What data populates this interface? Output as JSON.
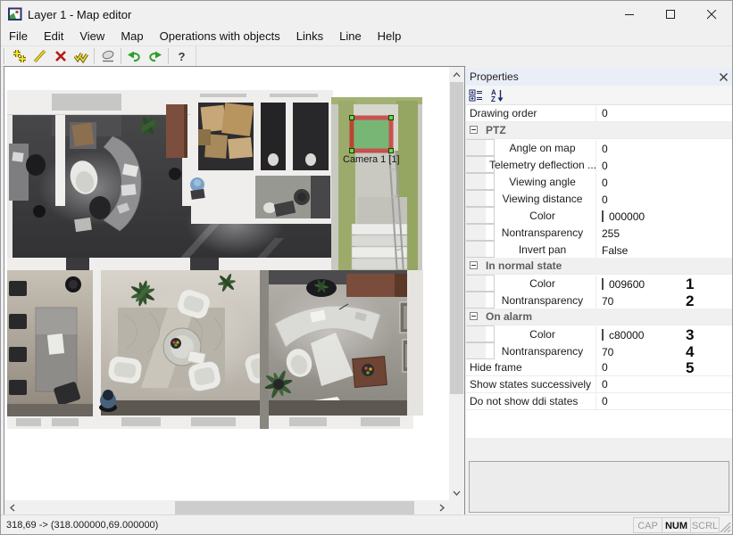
{
  "window": {
    "title": "Layer 1 - Map editor"
  },
  "menu": {
    "items": [
      "File",
      "Edit",
      "View",
      "Map",
      "Operations with objects",
      "Links",
      "Line",
      "Help"
    ]
  },
  "toolbar": {
    "buttons": [
      "Add points",
      "Draw line",
      "Delete",
      "Edit points",
      "Eraser",
      "Undo",
      "Redo",
      "Help"
    ]
  },
  "map_view": {
    "camera_label": "Camera 1 [1]"
  },
  "colors": {
    "camera_frame": "#c32020",
    "camera_fill": "#55aa55",
    "normal_state": "#009600",
    "alarm": "#c80000",
    "ptz_color": "#000000"
  },
  "properties_panel": {
    "title": "Properties",
    "toolbar_icons": [
      "categorized",
      "sort-alphabetical"
    ],
    "rows": [
      {
        "type": "item",
        "label": "Drawing order",
        "value": "0",
        "indent": false
      },
      {
        "type": "category",
        "label": "PTZ"
      },
      {
        "type": "item",
        "label": "Angle on map",
        "value": "0",
        "indent": true
      },
      {
        "type": "item",
        "label": "Telemetry deflection ...",
        "value": "0",
        "indent": true
      },
      {
        "type": "item",
        "label": "Viewing angle",
        "value": "0",
        "indent": true
      },
      {
        "type": "item",
        "label": "Viewing distance",
        "value": "0",
        "indent": true
      },
      {
        "type": "item",
        "label": "Color",
        "value": "000000",
        "swatch": "#000000",
        "indent": true
      },
      {
        "type": "item",
        "label": "Nontransparency",
        "value": "255",
        "indent": true
      },
      {
        "type": "item",
        "label": "Invert pan",
        "value": "False",
        "indent": true
      },
      {
        "type": "category",
        "label": "In normal state"
      },
      {
        "type": "item",
        "label": "Color",
        "value": "009600",
        "swatch": "#009600",
        "indent": true,
        "annotation": "1"
      },
      {
        "type": "item",
        "label": "Nontransparency",
        "value": "70",
        "indent": true,
        "annotation": "2"
      },
      {
        "type": "category",
        "label": "On alarm"
      },
      {
        "type": "item",
        "label": "Color",
        "value": "c80000",
        "swatch": "#c80000",
        "indent": true,
        "annotation": "3"
      },
      {
        "type": "item",
        "label": "Nontransparency",
        "value": "70",
        "indent": true,
        "annotation": "4"
      },
      {
        "type": "item",
        "label": "Hide frame",
        "value": "0",
        "indent": false,
        "annotation": "5"
      },
      {
        "type": "item",
        "label": "Show states successively",
        "value": "0",
        "indent": false
      },
      {
        "type": "item",
        "label": "Do not show ddi states",
        "value": "0",
        "indent": false
      }
    ]
  },
  "status_bar": {
    "position_text": "318,69 -> (318.000000,69.000000)",
    "indicators": [
      {
        "label": "CAP",
        "active": false
      },
      {
        "label": "NUM",
        "active": true
      },
      {
        "label": "SCRL",
        "active": false
      }
    ]
  }
}
